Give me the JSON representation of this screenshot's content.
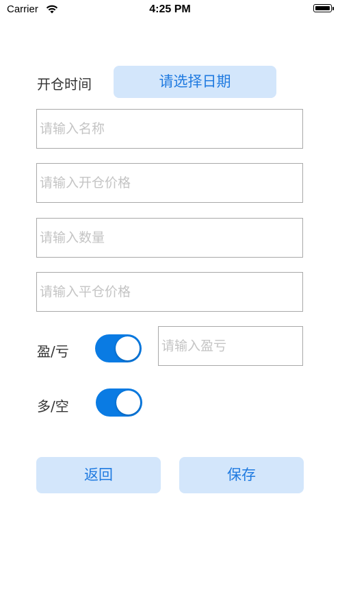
{
  "status_bar": {
    "carrier": "Carrier",
    "time": "4:25 PM"
  },
  "form": {
    "open_time_label": "开仓时间",
    "date_button": "请选择日期",
    "name_placeholder": "请输入名称",
    "open_price_placeholder": "请输入开仓价格",
    "quantity_placeholder": "请输入数量",
    "close_price_placeholder": "请输入平仓价格",
    "profit_loss_label": "盈/亏",
    "profit_loss_toggle_on": true,
    "profit_loss_placeholder": "请输入盈亏",
    "long_short_label": "多/空",
    "long_short_toggle_on": true
  },
  "actions": {
    "back_label": "返回",
    "save_label": "保存"
  },
  "colors": {
    "accent": "#1f7ae0",
    "button_bg": "#d3e6fb",
    "toggle_on": "#0a7be3",
    "field_border": "#a8a8a8",
    "placeholder": "#c4c4c4"
  }
}
